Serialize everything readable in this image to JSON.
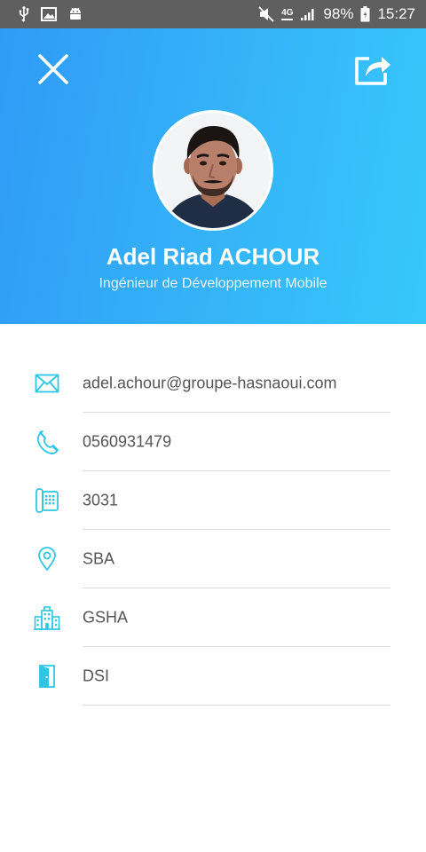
{
  "status_bar": {
    "battery_percent": "98%",
    "time": "15:27",
    "network_label": "4G",
    "left_icons": [
      "usb-icon",
      "image-icon",
      "android-icon"
    ],
    "right_icons": [
      "mute-icon",
      "network-4g-icon",
      "signal-icon",
      "battery-icon"
    ]
  },
  "header": {
    "gradient_start": "#2f9bf6",
    "gradient_end": "#36c8fb",
    "close_icon": "close-icon",
    "share_icon": "share-icon"
  },
  "profile": {
    "name": "Adel Riad ACHOUR",
    "role": "Ingénieur de Développement Mobile",
    "avatar": "avatar-photo"
  },
  "details": {
    "accent_color": "#2fc6e6",
    "items": [
      {
        "icon": "email-icon",
        "text": "adel.achour@groupe-hasnaoui.com"
      },
      {
        "icon": "phone-icon",
        "text": "0560931479"
      },
      {
        "icon": "desk-phone-icon",
        "text": "3031"
      },
      {
        "icon": "location-pin-icon",
        "text": "SBA"
      },
      {
        "icon": "building-icon",
        "text": "GSHA"
      },
      {
        "icon": "door-icon",
        "text": "DSI"
      }
    ]
  }
}
